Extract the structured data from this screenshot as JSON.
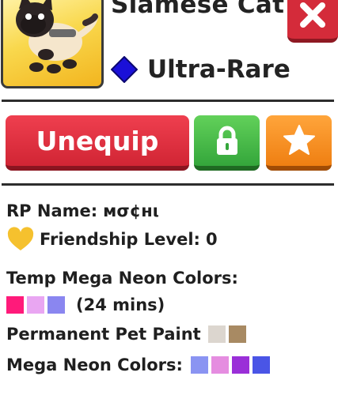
{
  "pet": {
    "name": "Siamese Cat",
    "rarity": "Ultra-Rare",
    "rarity_color": "#1a10d8"
  },
  "buttons": {
    "unequip_label": "Unequip",
    "lock_icon": "lock-icon",
    "favorite_icon": "star-icon",
    "close_icon": "close-icon"
  },
  "info": {
    "rp_name_label": "RP Name:",
    "rp_name_value": "мσ¢нι",
    "friendship_label": "Friendship Level:",
    "friendship_value": "0",
    "temp_colors_label": "Temp Mega Neon Colors:",
    "temp_colors": [
      "#ff1a7a",
      "#e9a6f2",
      "#8a86f0"
    ],
    "temp_duration": "(24 mins)",
    "pet_paint_label": "Permanent Pet Paint",
    "pet_paint_colors": [
      "#dcd6cf",
      "#a88a63"
    ],
    "mega_neon_label": "Mega Neon Colors:",
    "mega_neon_colors": [
      "#8a94f2",
      "#e58de0",
      "#9a2fd8",
      "#4a55e6"
    ]
  }
}
